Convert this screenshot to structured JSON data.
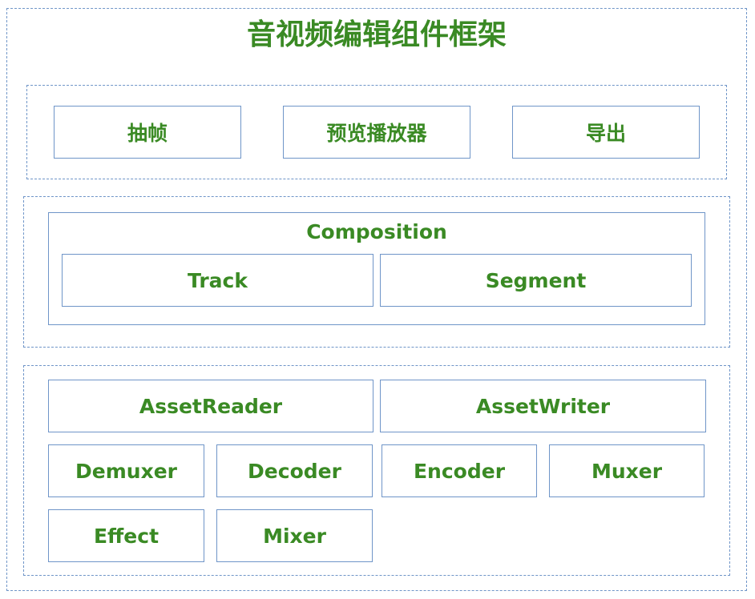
{
  "title": "音视频编辑组件框架",
  "top_layer": {
    "items": [
      "抽帧",
      "预览播放器",
      "导出"
    ]
  },
  "middle_layer": {
    "composition_label": "Composition",
    "items": [
      "Track",
      "Segment"
    ]
  },
  "bottom_layer": {
    "row1": [
      "AssetReader",
      "AssetWriter"
    ],
    "row2": [
      "Demuxer",
      "Decoder",
      "Encoder",
      "Muxer"
    ],
    "row3": [
      "Effect",
      "Mixer"
    ]
  },
  "colors": {
    "border": "#6f95c8",
    "text": "#3a8a24"
  }
}
